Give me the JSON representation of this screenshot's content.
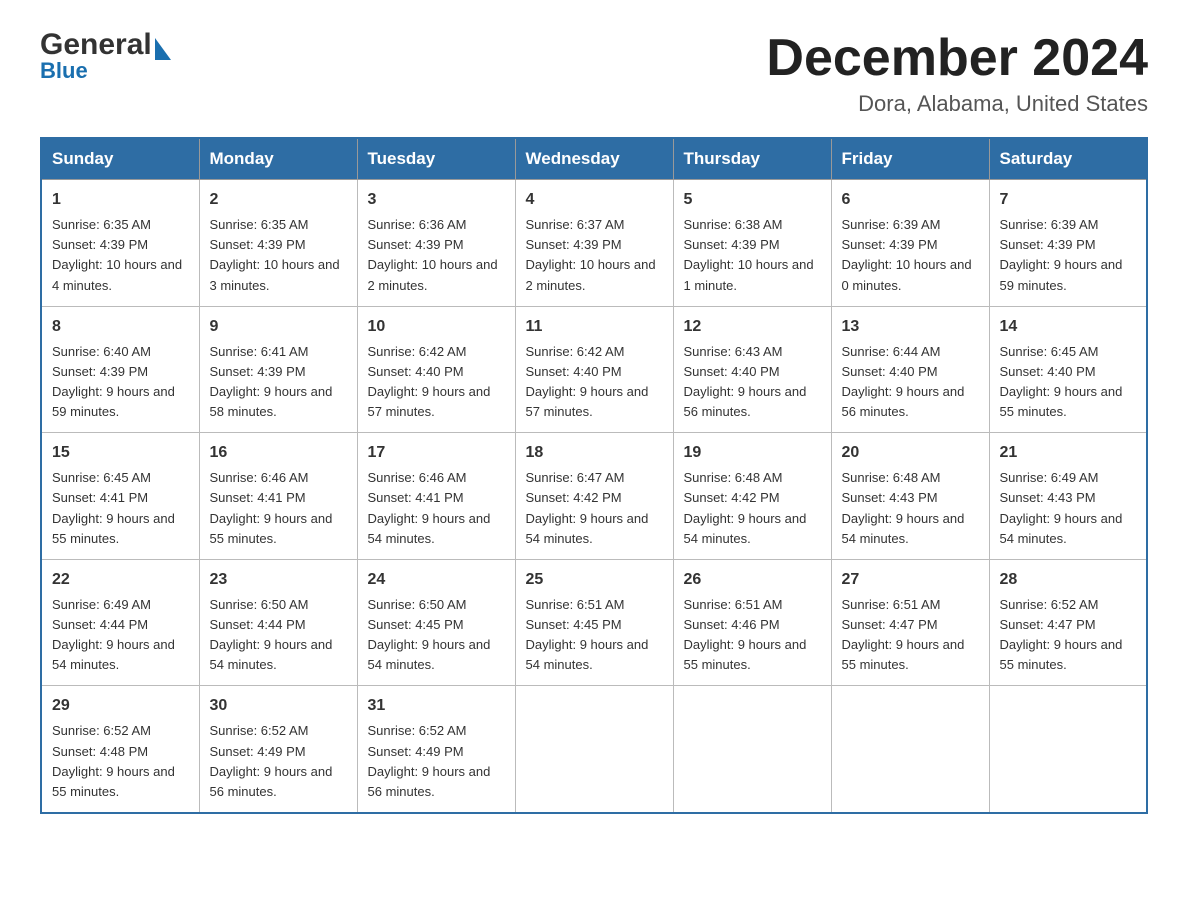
{
  "header": {
    "logo_general": "General",
    "logo_blue": "Blue",
    "month_title": "December 2024",
    "location": "Dora, Alabama, United States"
  },
  "weekdays": [
    "Sunday",
    "Monday",
    "Tuesday",
    "Wednesday",
    "Thursday",
    "Friday",
    "Saturday"
  ],
  "weeks": [
    [
      {
        "day": "1",
        "sunrise": "6:35 AM",
        "sunset": "4:39 PM",
        "daylight": "10 hours and 4 minutes."
      },
      {
        "day": "2",
        "sunrise": "6:35 AM",
        "sunset": "4:39 PM",
        "daylight": "10 hours and 3 minutes."
      },
      {
        "day": "3",
        "sunrise": "6:36 AM",
        "sunset": "4:39 PM",
        "daylight": "10 hours and 2 minutes."
      },
      {
        "day": "4",
        "sunrise": "6:37 AM",
        "sunset": "4:39 PM",
        "daylight": "10 hours and 2 minutes."
      },
      {
        "day": "5",
        "sunrise": "6:38 AM",
        "sunset": "4:39 PM",
        "daylight": "10 hours and 1 minute."
      },
      {
        "day": "6",
        "sunrise": "6:39 AM",
        "sunset": "4:39 PM",
        "daylight": "10 hours and 0 minutes."
      },
      {
        "day": "7",
        "sunrise": "6:39 AM",
        "sunset": "4:39 PM",
        "daylight": "9 hours and 59 minutes."
      }
    ],
    [
      {
        "day": "8",
        "sunrise": "6:40 AM",
        "sunset": "4:39 PM",
        "daylight": "9 hours and 59 minutes."
      },
      {
        "day": "9",
        "sunrise": "6:41 AM",
        "sunset": "4:39 PM",
        "daylight": "9 hours and 58 minutes."
      },
      {
        "day": "10",
        "sunrise": "6:42 AM",
        "sunset": "4:40 PM",
        "daylight": "9 hours and 57 minutes."
      },
      {
        "day": "11",
        "sunrise": "6:42 AM",
        "sunset": "4:40 PM",
        "daylight": "9 hours and 57 minutes."
      },
      {
        "day": "12",
        "sunrise": "6:43 AM",
        "sunset": "4:40 PM",
        "daylight": "9 hours and 56 minutes."
      },
      {
        "day": "13",
        "sunrise": "6:44 AM",
        "sunset": "4:40 PM",
        "daylight": "9 hours and 56 minutes."
      },
      {
        "day": "14",
        "sunrise": "6:45 AM",
        "sunset": "4:40 PM",
        "daylight": "9 hours and 55 minutes."
      }
    ],
    [
      {
        "day": "15",
        "sunrise": "6:45 AM",
        "sunset": "4:41 PM",
        "daylight": "9 hours and 55 minutes."
      },
      {
        "day": "16",
        "sunrise": "6:46 AM",
        "sunset": "4:41 PM",
        "daylight": "9 hours and 55 minutes."
      },
      {
        "day": "17",
        "sunrise": "6:46 AM",
        "sunset": "4:41 PM",
        "daylight": "9 hours and 54 minutes."
      },
      {
        "day": "18",
        "sunrise": "6:47 AM",
        "sunset": "4:42 PM",
        "daylight": "9 hours and 54 minutes."
      },
      {
        "day": "19",
        "sunrise": "6:48 AM",
        "sunset": "4:42 PM",
        "daylight": "9 hours and 54 minutes."
      },
      {
        "day": "20",
        "sunrise": "6:48 AM",
        "sunset": "4:43 PM",
        "daylight": "9 hours and 54 minutes."
      },
      {
        "day": "21",
        "sunrise": "6:49 AM",
        "sunset": "4:43 PM",
        "daylight": "9 hours and 54 minutes."
      }
    ],
    [
      {
        "day": "22",
        "sunrise": "6:49 AM",
        "sunset": "4:44 PM",
        "daylight": "9 hours and 54 minutes."
      },
      {
        "day": "23",
        "sunrise": "6:50 AM",
        "sunset": "4:44 PM",
        "daylight": "9 hours and 54 minutes."
      },
      {
        "day": "24",
        "sunrise": "6:50 AM",
        "sunset": "4:45 PM",
        "daylight": "9 hours and 54 minutes."
      },
      {
        "day": "25",
        "sunrise": "6:51 AM",
        "sunset": "4:45 PM",
        "daylight": "9 hours and 54 minutes."
      },
      {
        "day": "26",
        "sunrise": "6:51 AM",
        "sunset": "4:46 PM",
        "daylight": "9 hours and 55 minutes."
      },
      {
        "day": "27",
        "sunrise": "6:51 AM",
        "sunset": "4:47 PM",
        "daylight": "9 hours and 55 minutes."
      },
      {
        "day": "28",
        "sunrise": "6:52 AM",
        "sunset": "4:47 PM",
        "daylight": "9 hours and 55 minutes."
      }
    ],
    [
      {
        "day": "29",
        "sunrise": "6:52 AM",
        "sunset": "4:48 PM",
        "daylight": "9 hours and 55 minutes."
      },
      {
        "day": "30",
        "sunrise": "6:52 AM",
        "sunset": "4:49 PM",
        "daylight": "9 hours and 56 minutes."
      },
      {
        "day": "31",
        "sunrise": "6:52 AM",
        "sunset": "4:49 PM",
        "daylight": "9 hours and 56 minutes."
      },
      null,
      null,
      null,
      null
    ]
  ],
  "labels": {
    "sunrise": "Sunrise:",
    "sunset": "Sunset:",
    "daylight": "Daylight:"
  }
}
